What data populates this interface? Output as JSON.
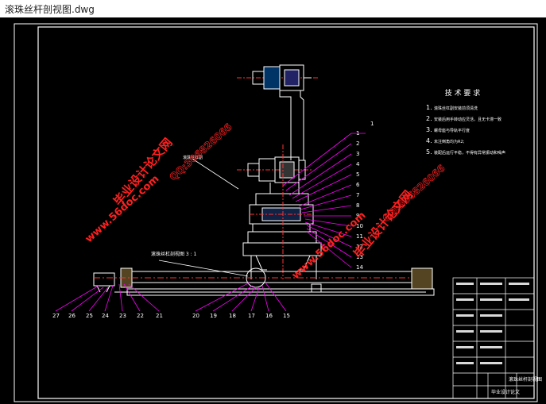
{
  "window": {
    "title": "滚珠丝杆剖视图.dwg"
  },
  "drawing": {
    "tech_title": "技 术 要 求",
    "tech_items": [
      "1.",
      "2.",
      "3.",
      "4.",
      "5."
    ],
    "tech_notes": [
      "滚珠丝杠副安装前须清洗",
      "安装后用手转动应灵活，且无卡滞一致",
      "螺母座与导轨平行度",
      "未注倒角均为R2;",
      "装配后运行平稳，不得有异常振动和噪声"
    ],
    "labels": {
      "section_note": "滚珠丝杠副",
      "detail_note": "滚珠丝杠剖视图  3 : 1",
      "top_one": "1"
    },
    "part_numbers_right": [
      "1",
      "2",
      "3",
      "4",
      "5",
      "6",
      "7",
      "8",
      "9",
      "10",
      "11",
      "12",
      "13",
      "14"
    ],
    "part_numbers_bottom": [
      "27",
      "26",
      "25",
      "24",
      "23",
      "22",
      "21",
      "20",
      "19",
      "18",
      "17",
      "16",
      "15"
    ],
    "title_block": {
      "drawing_name": "滚珠丝杆剖视图",
      "company": "毕业设计论文"
    },
    "watermarks": {
      "brand": "毕业设计论文网",
      "site": "www.56doc.com",
      "qq": "QQ:306826066"
    }
  },
  "colors": {
    "background": "#000000",
    "outline": "#ffffff",
    "leader": "#ff00ff",
    "centerline": "#ff3333",
    "watermark": "#ff2020",
    "frame": "#ffffff"
  }
}
